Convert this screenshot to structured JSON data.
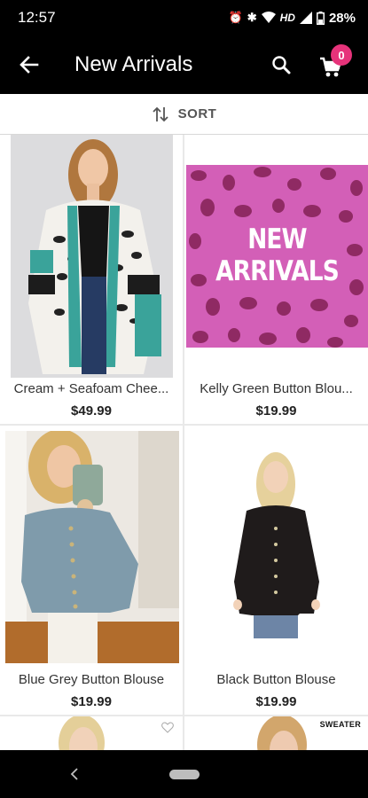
{
  "status_bar": {
    "time": "12:57",
    "network": "HD",
    "battery": "28%"
  },
  "app_bar": {
    "title": "New Arrivals",
    "cart_count": "0"
  },
  "sort": {
    "label": "SORT"
  },
  "products": [
    {
      "name": "Cream + Seafoam Cheetah Cardigan",
      "display_name": "Cream + Seafoam Chee...",
      "price": "$49.99"
    },
    {
      "name": "Kelly Green Button Blouse",
      "display_name": "Kelly Green Button Blou...",
      "price": "$19.99",
      "banner_line1": "NEW",
      "banner_line2": "ARRIVALS"
    },
    {
      "name": "Blue Grey Button Blouse",
      "display_name": "Blue Grey Button Blouse",
      "price": "$19.99"
    },
    {
      "name": "Black Button Blouse",
      "display_name": "Black Button Blouse",
      "price": "$19.99"
    }
  ],
  "partial_row": {
    "tag": "SWEATER"
  },
  "colors": {
    "bar_bg": "#000000",
    "badge": "#e6337a",
    "banner_pink": "#d35fb7",
    "banner_spots": "#8f2a63"
  }
}
